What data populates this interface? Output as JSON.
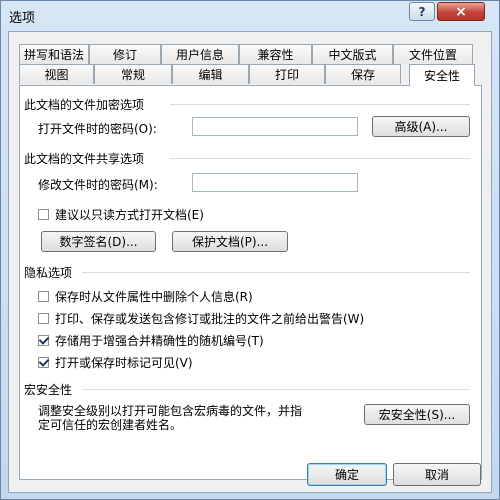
{
  "window": {
    "title": "选项",
    "help": "?",
    "close": "×"
  },
  "tabs_row1": [
    "拼写和语法",
    "修订",
    "用户信息",
    "兼容性",
    "中文版式",
    "文件位置"
  ],
  "tabs_row2": [
    "视图",
    "常规",
    "编辑",
    "打印",
    "保存",
    "安全性"
  ],
  "active_tab": "安全性",
  "encryption": {
    "title": "此文档的文件加密选项",
    "open_password_label": "打开文件时的密码(O):",
    "open_password_value": "",
    "advanced_button": "高级(A)..."
  },
  "sharing": {
    "title": "此文档的文件共享选项",
    "modify_password_label": "修改文件时的密码(M):",
    "modify_password_value": "",
    "readonly_label": "建议以只读方式打开文档(E)",
    "readonly_checked": false,
    "digital_signature_button": "数字签名(D)...",
    "protect_document_button": "保护文档(P)..."
  },
  "privacy": {
    "title": "隐私选项",
    "options": [
      {
        "label": "保存时从文件属性中删除个人信息(R)",
        "checked": false
      },
      {
        "label": "打印、保存或发送包含修订或批注的文件之前给出警告(W)",
        "checked": false
      },
      {
        "label": "存储用于增强合并精确性的随机编号(T)",
        "checked": true
      },
      {
        "label": "打开或保存时标记可见(V)",
        "checked": true
      }
    ]
  },
  "macro": {
    "title": "宏安全性",
    "description_line1": "调整安全级别以打开可能包含宏病毒的文件，并指",
    "description_line2": "定可信任的宏创建者姓名。",
    "button": "宏安全性(S)..."
  },
  "footer": {
    "ok": "确定",
    "cancel": "取消"
  }
}
